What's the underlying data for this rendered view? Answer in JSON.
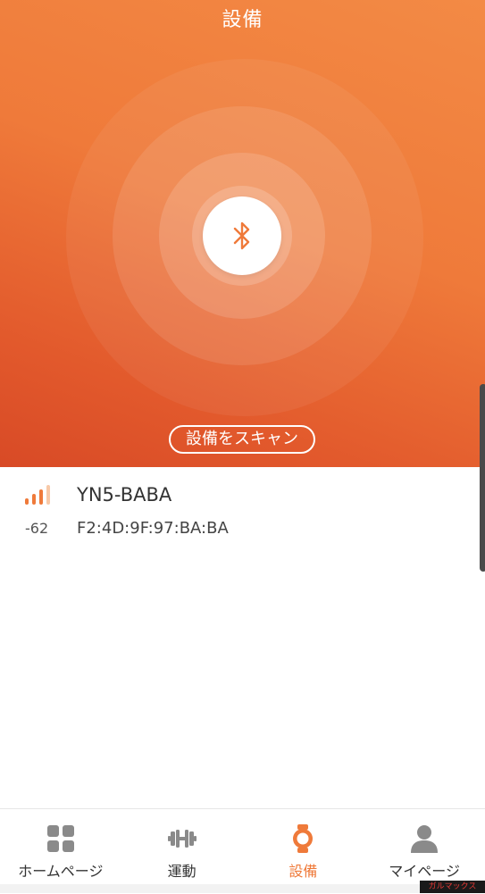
{
  "header": {
    "title": "設備"
  },
  "scan": {
    "button_label": "設備をスキャン"
  },
  "devices": [
    {
      "name": "YN5-BABA",
      "mac": "F2:4D:9F:97:BA:BA",
      "rssi": "-62"
    }
  ],
  "tabs": [
    {
      "label": "ホームページ",
      "icon": "grid-icon",
      "active": false
    },
    {
      "label": "運動",
      "icon": "dumbbell-icon",
      "active": false
    },
    {
      "label": "設備",
      "icon": "watch-icon",
      "active": true
    },
    {
      "label": "マイページ",
      "icon": "person-icon",
      "active": false
    }
  ],
  "watermark": {
    "text": "ガルマックス"
  },
  "colors": {
    "accent": "#ef7a3a",
    "hero_top": "#f38a45",
    "hero_bottom": "#d84a26",
    "inactive_icon": "#8a8a8a"
  }
}
